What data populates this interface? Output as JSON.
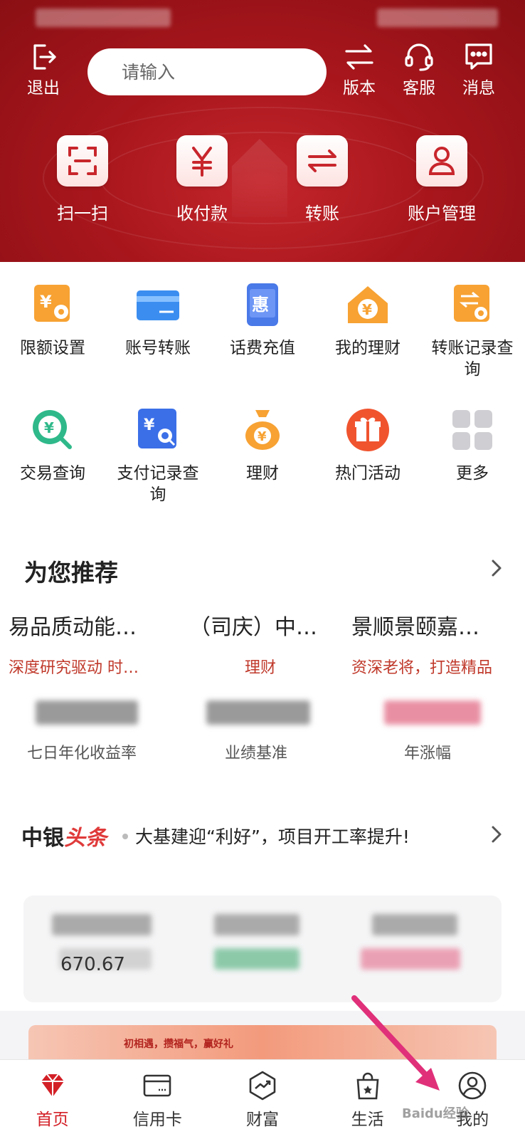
{
  "header": {
    "top_buttons": {
      "logout": "退出",
      "version": "版本",
      "service": "客服",
      "messages": "消息"
    },
    "search": {
      "placeholder": "请输入"
    },
    "quick_actions": [
      "扫一扫",
      "收付款",
      "转账",
      "账户管理"
    ]
  },
  "grid": {
    "row1": [
      "限额设置",
      "账号转账",
      "话费充值",
      "我的理财",
      "转账记录查询"
    ],
    "row2": [
      "交易查询",
      "支付记录查询",
      "理财",
      "热门活动",
      "更多"
    ]
  },
  "recommend": {
    "title": "为您推荐",
    "items": [
      {
        "name": "易品质动能…",
        "sub": "深度研究驱动 时…",
        "caption": "七日年化收益率"
      },
      {
        "name": "（司庆）中…",
        "sub": "理财",
        "caption": "业绩基准"
      },
      {
        "name": "景顺景颐嘉…",
        "sub": "资深老将，打造精品",
        "caption": "年涨幅"
      }
    ]
  },
  "news": {
    "logo_main": "中银",
    "logo_accent": "头条",
    "headline": "大基建迎“利好”，项目开工率提升!"
  },
  "market": {
    "partial_value": "670.67"
  },
  "banner": {
    "text": "初相遇，攒福气，赢好礼"
  },
  "nav": {
    "items": [
      "首页",
      "信用卡",
      "财富",
      "生活",
      "我的"
    ]
  },
  "watermark": "Baidu经验",
  "colors": {
    "brand_red": "#d32027",
    "header_red": "#a8161c",
    "sub_red": "#c0392b",
    "arrow_pink": "#e0307a"
  }
}
